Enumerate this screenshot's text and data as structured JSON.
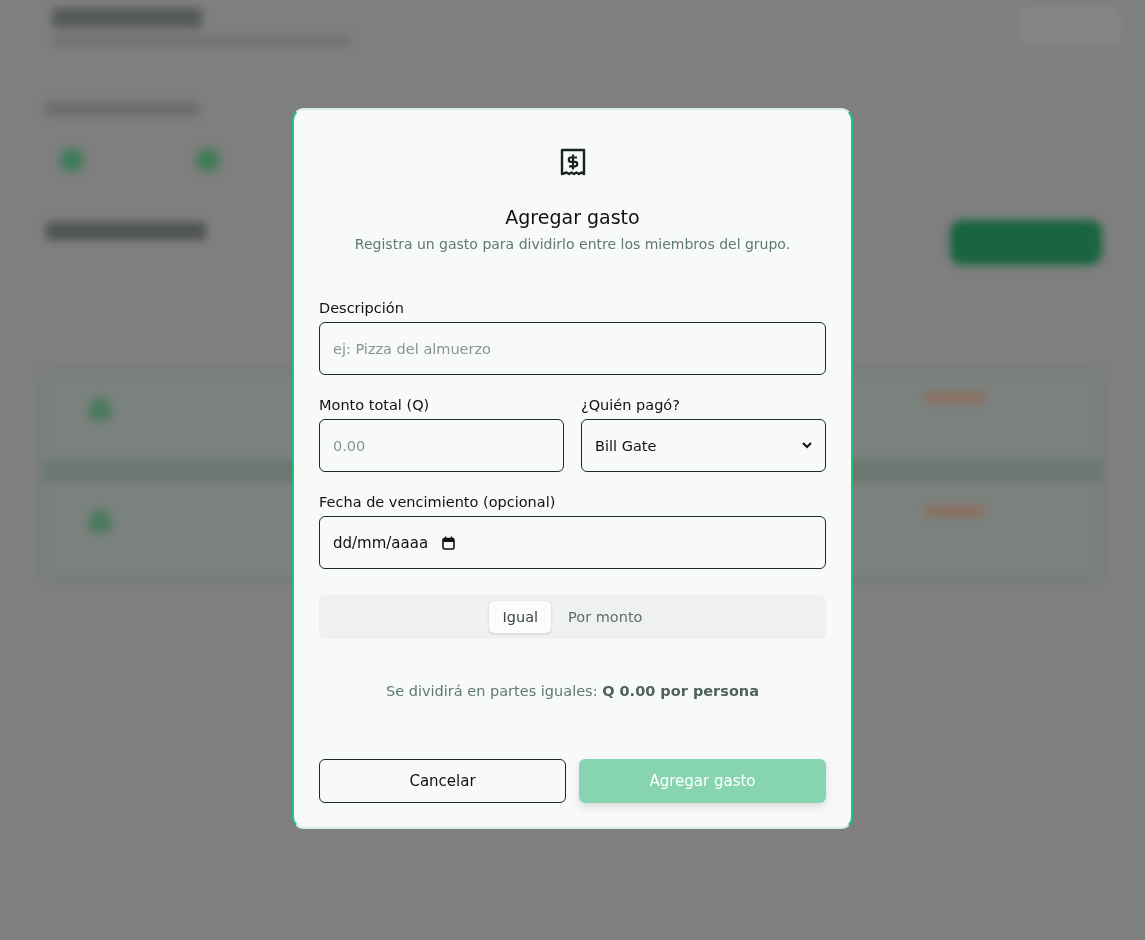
{
  "dialog": {
    "title": "Agregar gasto",
    "subtitle": "Registra un gasto para dividirlo entre los miembros del grupo.",
    "description": {
      "label": "Descripción",
      "placeholder": "ej: Pizza del almuerzo"
    },
    "amount": {
      "label": "Monto total (Q)",
      "placeholder": "0.00"
    },
    "payer": {
      "label": "¿Quién pagó?",
      "value": "Bill Gate"
    },
    "due_date": {
      "label": "Fecha de vencimiento (opcional)",
      "placeholder": "dd/mm/aaaa"
    },
    "split_tabs": [
      {
        "label": "Igual",
        "selected": true
      },
      {
        "label": "Por monto",
        "selected": false
      }
    ],
    "split_note": "Se dividirá en partes iguales: **Q 0.00 por persona**",
    "buttons": [
      {
        "label": "Cancelar",
        "kind": "secondary",
        "disabled": false
      },
      {
        "label": "Agregar gasto",
        "kind": "primary",
        "disabled": true
      }
    ]
  }
}
